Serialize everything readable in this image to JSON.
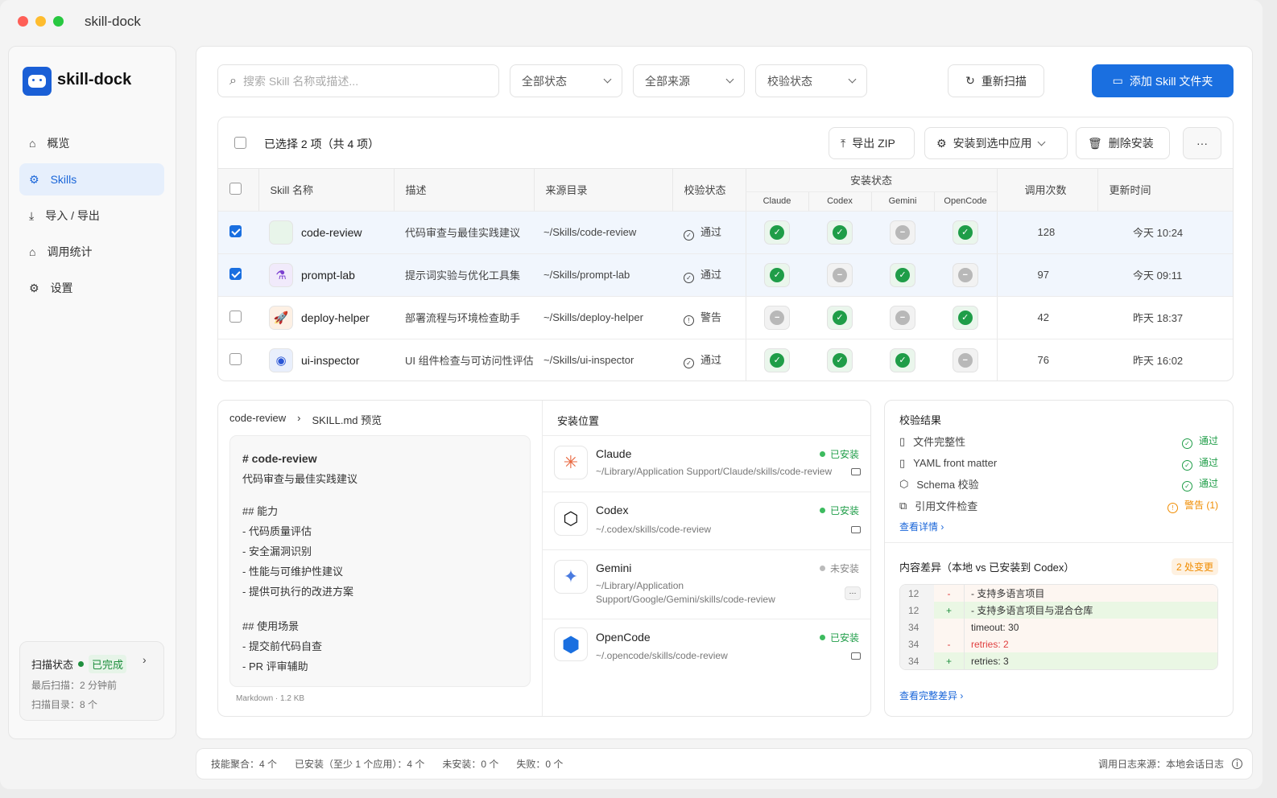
{
  "window": {
    "title": "skill-dock"
  },
  "sidebar": {
    "brand": "skill-dock",
    "items": [
      {
        "label": "概览"
      },
      {
        "label": "Skills"
      },
      {
        "label": "导入 / 导出"
      },
      {
        "label": "调用统计"
      },
      {
        "label": "设置"
      }
    ],
    "scan": {
      "title": "扫描状态",
      "status": "已完成",
      "last": "最后扫描：2 分钟前",
      "dirs": "扫描目录：8 个"
    }
  },
  "toolbar": {
    "search_placeholder": "搜索 Skill 名称或描述...",
    "filter_status": "全部状态",
    "filter_source": "全部来源",
    "filter_verify": "校验状态",
    "rescan": "重新扫描",
    "add_folder": "添加 Skill 文件夹"
  },
  "selection": {
    "text": "已选择 2 项（共 4 项）",
    "export": "导出 ZIP",
    "install": "安装到选中应用",
    "delete": "删除安装",
    "more": "···"
  },
  "table": {
    "headers": {
      "name": "Skill 名称",
      "desc": "描述",
      "source": "来源目录",
      "verify": "校验状态",
      "install": "安装状态",
      "apps": [
        "Claude",
        "Codex",
        "Gemini",
        "OpenCode"
      ],
      "calls": "调用次数",
      "updated": "更新时间"
    },
    "rows": [
      {
        "selected": true,
        "icon": "code-icon",
        "glyph": "</>",
        "color": "#1f9d48",
        "bg": "#e8f5ea",
        "name": "code-review",
        "desc": "代码审查与最佳实践建议",
        "source": "~/Skills/code-review",
        "verify": "通过",
        "verify_state": "pass",
        "install": [
          true,
          true,
          false,
          true
        ],
        "calls": "128",
        "updated": "今天 10:24"
      },
      {
        "selected": true,
        "icon": "flask-icon",
        "glyph": "⚗",
        "color": "#7b3fd0",
        "bg": "#f1eafb",
        "name": "prompt-lab",
        "desc": "提示词实验与优化工具集",
        "source": "~/Skills/prompt-lab",
        "verify": "通过",
        "verify_state": "pass",
        "install": [
          true,
          false,
          true,
          false
        ],
        "calls": "97",
        "updated": "今天 09:11"
      },
      {
        "selected": false,
        "icon": "rocket-icon",
        "glyph": "🚀",
        "color": "#f06a1d",
        "bg": "#fdf0e4",
        "name": "deploy-helper",
        "desc": "部署流程与环境检查助手",
        "source": "~/Skills/deploy-helper",
        "verify": "警告",
        "verify_state": "warn",
        "install": [
          false,
          true,
          false,
          true
        ],
        "calls": "42",
        "updated": "昨天 18:37"
      },
      {
        "selected": false,
        "icon": "eye-icon",
        "glyph": "◉",
        "color": "#2a56d6",
        "bg": "#e9effc",
        "name": "ui-inspector",
        "desc": "UI 组件检查与可访问性评估",
        "source": "~/Skills/ui-inspector",
        "verify": "通过",
        "verify_state": "pass",
        "install": [
          true,
          true,
          true,
          false
        ],
        "calls": "76",
        "updated": "昨天 16:02"
      }
    ]
  },
  "preview": {
    "crumb": "code-review",
    "title": "SKILL.md 预览",
    "h1": "#  code-review",
    "desc": "代码审查与最佳实践建议",
    "h2a": "##  能力",
    "list_a": [
      "-  代码质量评估",
      "-  安全漏洞识别",
      "-  性能与可维护性建议",
      "-  提供可执行的改进方案"
    ],
    "h2b": "##  使用场景",
    "list_b": [
      "-  提交前代码自查",
      "-  PR  评审辅助"
    ],
    "meta": "Markdown · 1.2 KB"
  },
  "install": {
    "title": "安装位置",
    "items": [
      {
        "name": "Claude",
        "path": "~/Library/Application Support/Claude/skills/code-review",
        "status": "已安装"
      },
      {
        "name": "Codex",
        "path": "~/.codex/skills/code-review",
        "status": "已安装"
      },
      {
        "name": "Gemini",
        "path": "~/Library/Application Support/Google/Gemini/skills/code-review",
        "status": "未安装"
      },
      {
        "name": "OpenCode",
        "path": "~/.opencode/skills/code-review",
        "status": "已安装"
      }
    ]
  },
  "verify": {
    "title": "校验结果",
    "items": [
      {
        "label": "文件完整性",
        "result": "通过"
      },
      {
        "label": "YAML front matter",
        "result": "通过"
      },
      {
        "label": "Schema 校验",
        "result": "通过"
      },
      {
        "label": "引用文件检查",
        "result": "警告 (1)"
      }
    ],
    "details": "查看详情"
  },
  "diff": {
    "title": "内容差异（本地 vs 已安装到 Codex）",
    "badge": "2 处变更",
    "lines": [
      {
        "ln": "12",
        "sign": "-",
        "text": "-  支持多语言项目",
        "type": "del"
      },
      {
        "ln": "12",
        "sign": "+",
        "text": "-  支持多语言项目与混合仓库",
        "type": "add"
      },
      {
        "ln": "34",
        "sign": "",
        "text": "timeout: 30",
        "type": "ctx"
      },
      {
        "ln": "34",
        "sign": "-",
        "text": "retries: 2",
        "type": "del"
      },
      {
        "ln": "34",
        "sign": "+",
        "text": "retries: 3",
        "type": "add"
      }
    ],
    "full": "查看完整差异"
  },
  "footer": {
    "total": "技能聚合：4 个",
    "installed": "已安装（至少 1 个应用）：4 个",
    "not_installed": "未安装：0 个",
    "failed": "失败：0 个",
    "log_source": "调用日志来源：本地会话日志"
  }
}
